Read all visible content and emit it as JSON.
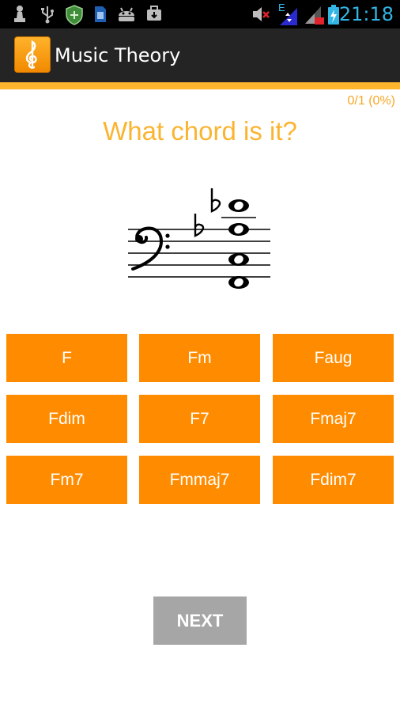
{
  "status_bar": {
    "time": "21:18",
    "network_label": "E",
    "icons_left": [
      "chess-pawn-icon",
      "usb-icon",
      "shield-icon",
      "sim-icon",
      "android-icon",
      "briefcase-icon"
    ],
    "icons_right": [
      "mute-icon",
      "data-network-icon",
      "signal-icon",
      "battery-charging-icon"
    ]
  },
  "action_bar": {
    "title": "Music Theory",
    "app_icon": "treble-clef-icon"
  },
  "quiz": {
    "progress": "0/1 (0%)",
    "question": "What chord is it?",
    "accent_color": "#ff8c00",
    "chord_options": [
      "F",
      "Fm",
      "Faug",
      "Fdim",
      "F7",
      "Fmaj7",
      "Fm7",
      "Fmmaj7",
      "Fdim7"
    ],
    "next_label": "NEXT"
  }
}
